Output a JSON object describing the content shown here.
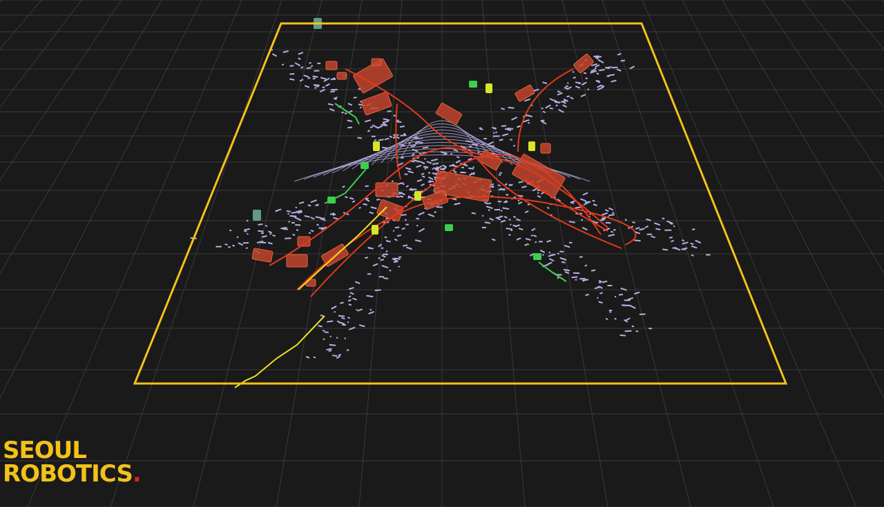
{
  "logo": {
    "line1": "SEOUL",
    "line2": "ROBOTICS",
    "dot": "."
  },
  "colors": {
    "background": "#1a1a1a",
    "grid": "#3a3a3a",
    "zone_outline": "#f2c21b",
    "point_cloud": "#b8b0e6",
    "vehicle_box": "#c2452e",
    "vehicle_track": "#e23a1a",
    "pedestrian_box": "#d6e628",
    "pedestrian_track": "#f0e020",
    "cyclist": "#3ccf4e",
    "static_object": "#7fd1b8",
    "logo": "#f2c21b",
    "logo_dot": "#e31e24"
  },
  "legend_semantics": [
    "tracked-vehicle",
    "tracked-pedestrian",
    "tracked-cyclist",
    "lidar-point-cloud",
    "monitoring-zone"
  ]
}
